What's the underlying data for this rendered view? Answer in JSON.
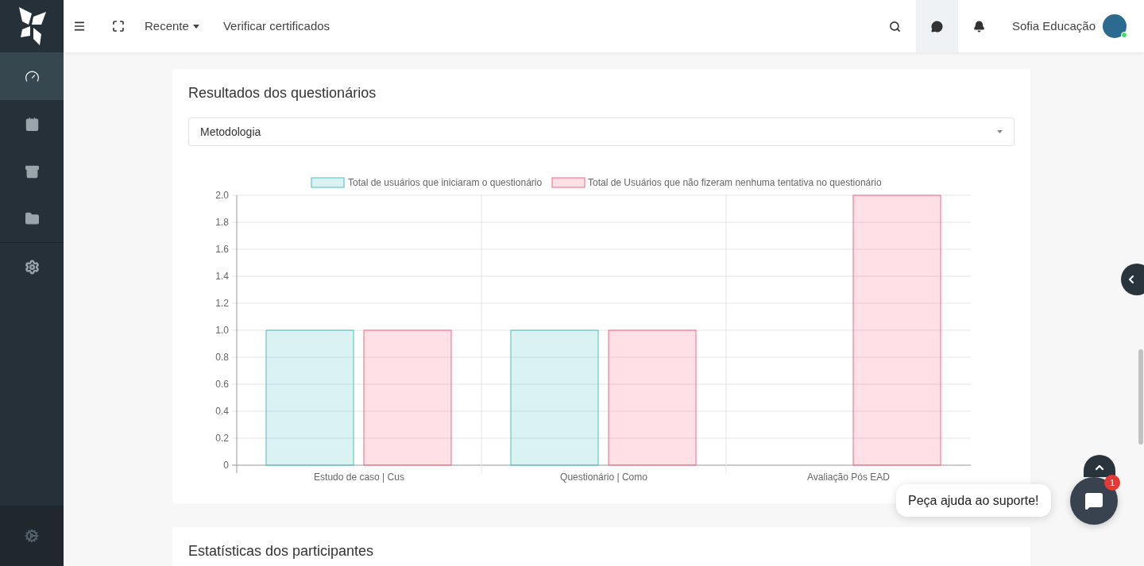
{
  "header": {
    "nav": [
      {
        "label": "Recente",
        "kind": "dropdown"
      },
      {
        "label": "Verificar certificados",
        "kind": "link"
      }
    ],
    "actions": [
      {
        "kind": "search",
        "selected": false
      },
      {
        "kind": "messages",
        "selected": true
      },
      {
        "kind": "notifications",
        "selected": false
      }
    ],
    "user_name": "Sofia Educação",
    "user_online": true
  },
  "sidebar": {
    "items": [
      {
        "kind": "dashboard",
        "selected": true
      },
      {
        "kind": "calendar",
        "selected": false
      },
      {
        "kind": "archive",
        "selected": false
      },
      {
        "kind": "folder",
        "selected": false
      },
      {
        "kind": "settings",
        "selected": false
      }
    ]
  },
  "quiz_results": {
    "title": "Resultados dos questionários",
    "select": {
      "value": "Metodologia"
    },
    "chart_data": {
      "type": "bar",
      "categories": [
        "Estudo de caso | Cus",
        "Questionário | Como",
        "Avaliação Pós EAD"
      ],
      "series": [
        {
          "name": "Total de usuários que iniciaram o questionário",
          "color": "#4bc0c0",
          "values": [
            1,
            1,
            0
          ]
        },
        {
          "name": "Total de Usuários que não fizeram nenhuma tentativa no questionário",
          "color": "#ff6384",
          "values": [
            1,
            1,
            2
          ]
        }
      ],
      "ylim": [
        0,
        2
      ],
      "grid": true,
      "legend": true,
      "yticks": [
        {
          "value": 0,
          "label": "0"
        },
        {
          "value": 0.2,
          "label": "0.2"
        },
        {
          "value": 0.4,
          "label": "0.4"
        },
        {
          "value": 0.6,
          "label": "0.6"
        },
        {
          "value": 0.8,
          "label": "0.8"
        },
        {
          "value": 1,
          "label": "1.0"
        },
        {
          "value": 1.2,
          "label": "1.2"
        },
        {
          "value": 1.4,
          "label": "1.4"
        },
        {
          "value": 1.6,
          "label": "1.6"
        },
        {
          "value": 1.8,
          "label": "1.8"
        },
        {
          "value": 2,
          "label": "2.0"
        }
      ]
    }
  },
  "participant_stats": {
    "title": "Estatísticas dos participantes"
  },
  "support": {
    "bubble": "Peça ajuda ao suporte!",
    "badge": "1"
  }
}
